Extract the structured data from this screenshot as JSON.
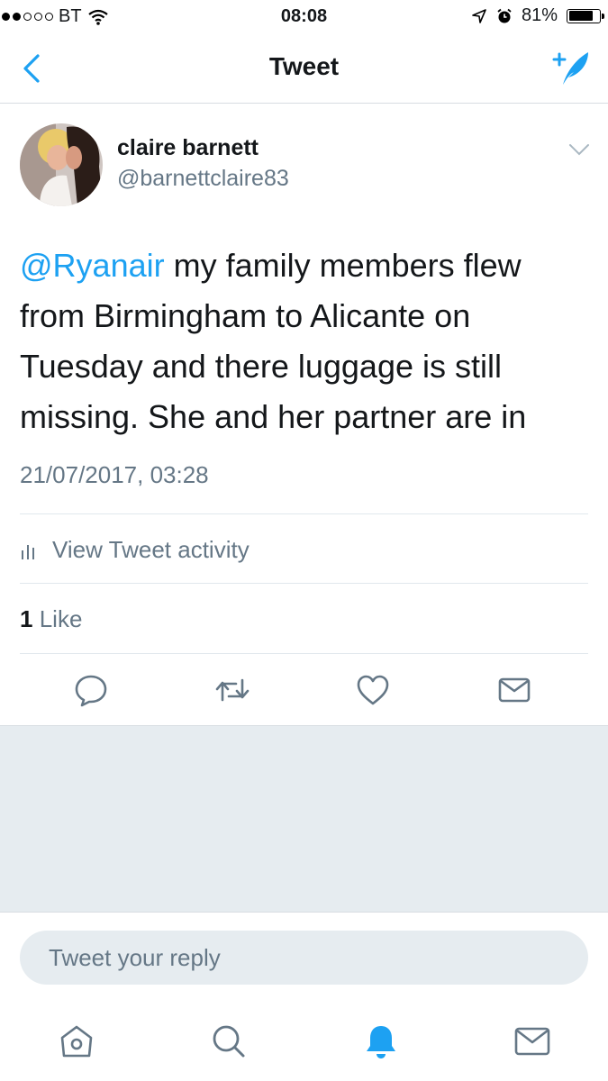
{
  "status_bar": {
    "carrier": "BT",
    "time": "08:08",
    "battery": "81%",
    "battery_level": 0.81
  },
  "nav": {
    "title": "Tweet"
  },
  "tweet": {
    "display_name": "claire barnett",
    "handle": "@barnettclaire83",
    "mention": "@Ryanair",
    "body": " my family members flew from Birmingham to Alicante on Tuesday and there luggage is still missing. She and her partner are in",
    "timestamp": "21/07/2017, 03:28",
    "activity_label": "View Tweet activity",
    "like_count": "1",
    "like_label": "Like"
  },
  "actions": {
    "icons": [
      "reply-icon",
      "retweet-icon",
      "like-icon",
      "direct-message-icon"
    ]
  },
  "reply": {
    "placeholder": "Tweet your reply"
  },
  "tabbar": {
    "icons": [
      "home-icon",
      "search-icon",
      "notifications-icon",
      "messages-icon"
    ]
  },
  "colors": {
    "accent": "#1da1f2",
    "secondary_text": "#657786",
    "divider": "#e1e8ed",
    "gray_background": "#e6ecf0"
  }
}
